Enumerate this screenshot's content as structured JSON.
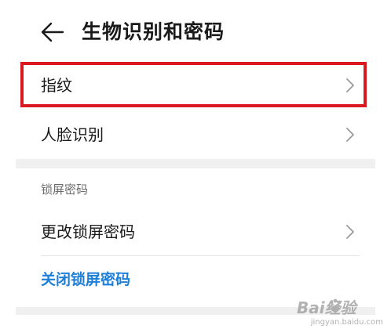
{
  "header": {
    "title": "生物识别和密码",
    "back_icon": "arrow-left-icon"
  },
  "biometrics": {
    "items": [
      {
        "label": "指纹",
        "icon": "chevron-right-icon",
        "highlighted": true
      },
      {
        "label": "人脸识别",
        "icon": "chevron-right-icon",
        "highlighted": false
      }
    ]
  },
  "lock_screen": {
    "section_title": "锁屏密码",
    "change_label": "更改锁屏密码",
    "change_icon": "chevron-right-icon",
    "close_label": "关闭锁屏密码"
  },
  "colors": {
    "highlight_border": "#d9191f",
    "link": "#1e7fd9",
    "section_gap": "#f0f0f0",
    "text": "#1a1a1a",
    "secondary_text": "#6b6b6b"
  },
  "watermark": {
    "main": "Bai经验",
    "sub": "jingyan.baidu.com"
  }
}
